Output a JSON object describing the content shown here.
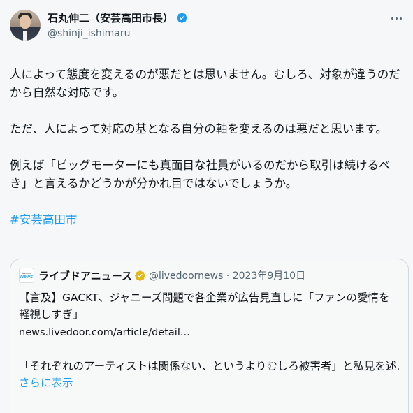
{
  "author": {
    "display_name": "石丸伸二（安芸高田市長）",
    "handle": "@shinji_ishimaru"
  },
  "tweet": {
    "paragraphs": [
      "人によって態度を変えるのが悪だとは思いません。むしろ、対象が違うのだから自然な対応です。",
      "ただ、人によって対応の基となる自分の軸を変えるのは悪だと思います。",
      "例えば「ビッグモーターにも真面目な社員がいるのだから取引は続けるべき」と言えるかどうかが分かれ目ではないでしょうか。"
    ],
    "hashtag": "#安芸高田市"
  },
  "quote": {
    "avatar_top_text": "livedoor",
    "avatar_bottom_text": "News",
    "name": "ライブドアニュース",
    "handle_date": "@livedoornews · 2023年9月10日",
    "text": "【言及】GACKT、ジャニーズ問題で各企業が広告見直しに「ファンの愛情を軽視しすぎ」",
    "link": "news.livedoor.com/article/detail...",
    "excerpt": "「それぞれのアーティストは関係ない、というよりむしろ被害者」と私見を述...",
    "show_more": "さらに表示"
  },
  "colors": {
    "link_blue": "#1d9bf0",
    "verified_blue": "#1d9bf0",
    "verified_gold": "#e2b719",
    "secondary_text": "#536471"
  },
  "icons": {
    "verified": "verified-badge-icon",
    "more": "more-horizontal-icon",
    "gold_badge": "gold-verified-badge-icon"
  }
}
